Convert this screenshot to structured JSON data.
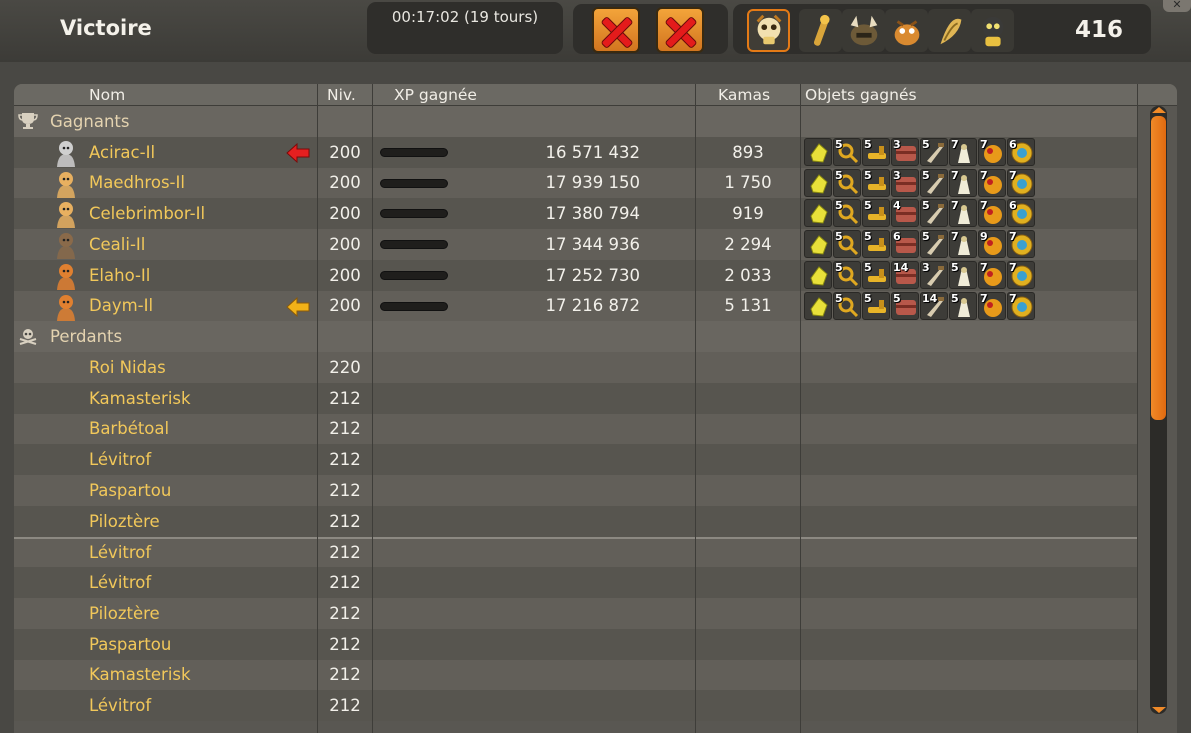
{
  "header": {
    "title": "Victoire",
    "timer": "00:17:02 (19 tours)",
    "score": "416",
    "monsters": [
      {
        "icon": "creature-skull-icon",
        "selected": true
      },
      {
        "icon": "creature-stick-icon",
        "selected": false
      },
      {
        "icon": "creature-horned-icon",
        "selected": false
      },
      {
        "icon": "creature-beast-icon",
        "selected": false
      },
      {
        "icon": "creature-shell-icon",
        "selected": false
      },
      {
        "icon": "creature-mask-icon",
        "selected": false
      }
    ]
  },
  "table": {
    "columns": {
      "name": "Nom",
      "level": "Niv.",
      "xp": "XP gagnée",
      "kamas": "Kamas",
      "items": "Objets gagnés"
    },
    "winners_label": "Gagnants",
    "losers_label": "Perdants",
    "winners": [
      {
        "name": "Acirac-Il",
        "level": "200",
        "xp": "16 571 432",
        "kamas": "893",
        "arrow": "red",
        "items": [
          "",
          "5",
          "5",
          "3",
          "5",
          "7",
          "7",
          "6"
        ]
      },
      {
        "name": "Maedhros-Il",
        "level": "200",
        "xp": "17 939 150",
        "kamas": "1 750",
        "arrow": "",
        "items": [
          "",
          "5",
          "5",
          "3",
          "5",
          "7",
          "7",
          "7"
        ]
      },
      {
        "name": "Celebrimbor-Il",
        "level": "200",
        "xp": "17 380 794",
        "kamas": "919",
        "arrow": "",
        "items": [
          "",
          "5",
          "5",
          "4",
          "5",
          "7",
          "7",
          "6"
        ]
      },
      {
        "name": "Ceali-Il",
        "level": "200",
        "xp": "17 344 936",
        "kamas": "2 294",
        "arrow": "",
        "items": [
          "",
          "5",
          "5",
          "6",
          "5",
          "7",
          "9",
          "7"
        ]
      },
      {
        "name": "Elaho-Il",
        "level": "200",
        "xp": "17 252 730",
        "kamas": "2 033",
        "arrow": "",
        "items": [
          "",
          "5",
          "5",
          "14",
          "3",
          "5",
          "7",
          "7"
        ]
      },
      {
        "name": "Daym-Il",
        "level": "200",
        "xp": "17 216 872",
        "kamas": "5 131",
        "arrow": "yellow",
        "items": [
          "",
          "5",
          "5",
          "5",
          "14",
          "5",
          "7",
          "7"
        ]
      }
    ],
    "losers": [
      {
        "name": "Roi Nidas",
        "level": "220"
      },
      {
        "name": "Kamasterisk",
        "level": "212"
      },
      {
        "name": "Barbétoal",
        "level": "212"
      },
      {
        "name": "Lévitrof",
        "level": "212"
      },
      {
        "name": "Paspartou",
        "level": "212"
      },
      {
        "name": "Piloztère",
        "level": "212"
      },
      {
        "name": "Lévitrof",
        "level": "212"
      },
      {
        "name": "Lévitrof",
        "level": "212"
      },
      {
        "name": "Piloztère",
        "level": "212"
      },
      {
        "name": "Paspartou",
        "level": "212"
      },
      {
        "name": "Kamasterisk",
        "level": "212"
      },
      {
        "name": "Lévitrof",
        "level": "212"
      }
    ]
  }
}
